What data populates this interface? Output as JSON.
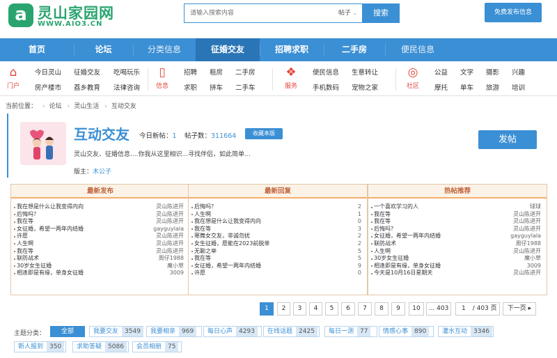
{
  "header": {
    "logo_mark": "a",
    "site_name": "灵山家园网",
    "site_url": "WWW.AIO3.CN",
    "search_placeholder": "请输入搜索内容",
    "search_category": "帖子",
    "search_button": "搜索",
    "post_free_button": "免费发布信息"
  },
  "nav": [
    "首页",
    "论坛",
    "分类信息",
    "征婚交友",
    "招聘求职",
    "二手房",
    "便民信息"
  ],
  "nav_active": "征婚交友",
  "subnav": {
    "portal": {
      "icon": "⌂",
      "label": "门户",
      "links": [
        "今日灵山",
        "征婚交友",
        "吃喝玩乐",
        "房产楼市",
        "荔乡教育",
        "法律咨询"
      ]
    },
    "info": {
      "icon": "▯",
      "label": "信息",
      "links": [
        "招聘",
        "租房",
        "二手房",
        "求职",
        "拼车",
        "二手车"
      ]
    },
    "service": {
      "icon": "❖",
      "label": "服务",
      "links": [
        "便民信息",
        "生意转让",
        "手机数码",
        "宠物之家"
      ]
    },
    "community": {
      "icon": "◎",
      "label": "社区",
      "links": [
        "公益",
        "文学",
        "摄影",
        "兴趣",
        "摩托",
        "单车",
        "旅游",
        "培训"
      ]
    }
  },
  "breadcrumb": [
    "当前位置：",
    "论坛",
    "灵山生活",
    "互动交友"
  ],
  "board": {
    "title": "互动交友",
    "today_label": "今日新帖：",
    "today_value": "1",
    "posts_label": "帖子数：",
    "posts_value": "311664",
    "favorite_button": "收藏本版",
    "description": "灵山交友、征婚信息....你我从这里相识...寻找伴侣，如此简单...",
    "moderator_label": "版主：",
    "moderator_value": "木公子",
    "post_button": "发帖"
  },
  "panels": [
    {
      "title": "最新发布",
      "items": [
        {
          "text": "我在想是什么让我变得内向",
          "right": "灵山陈进开"
        },
        {
          "text": "后悔吗？",
          "right": "灵山陈进开"
        },
        {
          "text": "我在等",
          "right": "灵山陈进开"
        },
        {
          "text": "女征婚，希望一两年内结婚",
          "right": "gayguylala"
        },
        {
          "text": "许愿",
          "right": "灵山陈进开"
        },
        {
          "text": "人生啊",
          "right": "灵山陈进开"
        },
        {
          "text": "我在等",
          "right": "灵山陈进开"
        },
        {
          "text": "联防战术",
          "right": "周仔1988"
        },
        {
          "text": "30岁女生征婚",
          "right": "魔小草"
        },
        {
          "text": "相逢即是有缘，单身女征婚",
          "right": "3009"
        }
      ]
    },
    {
      "title": "最新回复",
      "items": [
        {
          "text": "后悔吗？",
          "right": "2"
        },
        {
          "text": "人生啊",
          "right": "1"
        },
        {
          "text": "我在想是什么让我变得内向",
          "right": "0"
        },
        {
          "text": "我在等",
          "right": "3"
        },
        {
          "text": "寒舞女交友，非诚勿扰",
          "right": "2"
        },
        {
          "text": "女生征婚，愿能在2023前脱单",
          "right": "2"
        },
        {
          "text": "无聊之举",
          "right": "5"
        },
        {
          "text": "我在等",
          "right": "5"
        },
        {
          "text": "女征婚，希望一两年内结婚",
          "right": "9"
        },
        {
          "text": "许愿",
          "right": "0"
        }
      ]
    },
    {
      "title": "热帖推荐",
      "items": [
        {
          "text": "一个喜欢学习的人",
          "right": "球球"
        },
        {
          "text": "我在等",
          "right": "灵山陈进开"
        },
        {
          "text": "我在等",
          "right": "灵山陈进开"
        },
        {
          "text": "后悔吗？",
          "right": "灵山陈进开"
        },
        {
          "text": "女征婚，希望一两年内结婚",
          "right": "gayguylala"
        },
        {
          "text": "联防战术",
          "right": "周仔1988"
        },
        {
          "text": "人生啊",
          "right": "灵山陈进开"
        },
        {
          "text": "30岁女生征婚",
          "right": "魔小草"
        },
        {
          "text": "相逢即是有缘，单身女征婚",
          "right": "3009"
        },
        {
          "text": "今天是10月16日星期天",
          "right": "灵山陈进开"
        }
      ]
    }
  ],
  "pagination": {
    "pages": [
      "1",
      "2",
      "3",
      "4",
      "5",
      "6",
      "7",
      "8",
      "9",
      "10",
      "... 403"
    ],
    "current": "1",
    "input_value": "1",
    "total": "/ 403 页",
    "next": "下一页"
  },
  "tags": {
    "label": "主题分类：",
    "all": "全部",
    "items": [
      {
        "name": "我要交友",
        "count": "3549"
      },
      {
        "name": "我要相亲",
        "count": "969"
      },
      {
        "name": "每日心声",
        "count": "4293"
      },
      {
        "name": "在线话题",
        "count": "2425"
      },
      {
        "name": "每日一测",
        "count": "77"
      },
      {
        "name": "情感心事",
        "count": "890"
      },
      {
        "name": "灌水互动",
        "count": "3346"
      },
      {
        "name": "新人报到",
        "count": "350"
      },
      {
        "name": "求助答疑",
        "count": "5086"
      },
      {
        "name": "会员相册",
        "count": "75"
      }
    ]
  },
  "colors": {
    "accent": "#3b8fd4",
    "brand": "#2aa46f",
    "icon_red": "#e0463c",
    "panel_title": "#c0643c"
  }
}
